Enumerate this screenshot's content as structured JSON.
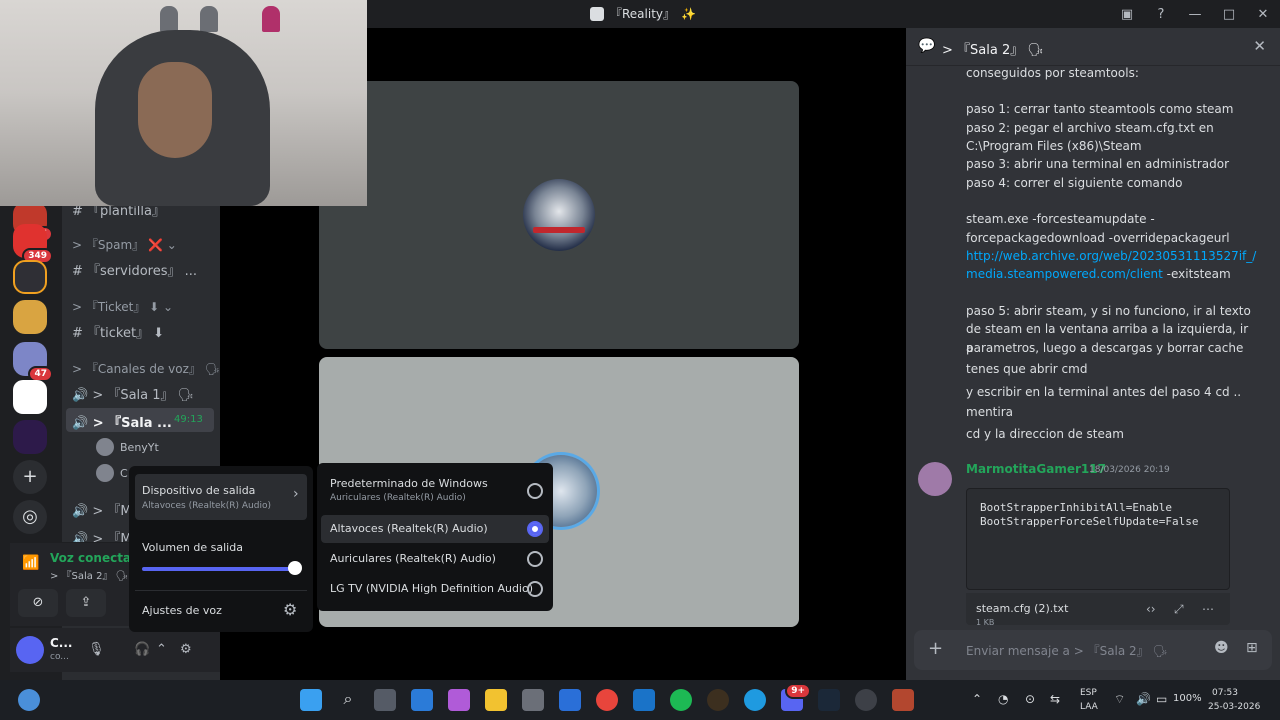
{
  "window": {
    "title": "『Reality』",
    "title_suffix": "✨",
    "controls": [
      "▣",
      "?",
      "—",
      "□",
      "✕"
    ]
  },
  "rail": {
    "badges": [
      "26",
      "349",
      "47"
    ]
  },
  "channels": {
    "items": [
      {
        "label": "#  『plantilla』"
      },
      {
        "label": "> 『Spam』 ❌ ⌄"
      },
      {
        "label": "#  『servidores』 ..."
      },
      {
        "label": "> 『Ticket』 ⬇ ⌄"
      },
      {
        "label": "#  『ticket』 ⬇"
      },
      {
        "label": "> 『Canales de voz』 🗣 ⌄"
      },
      {
        "label": "🔊 > 『Sala 1』 🗣"
      },
      {
        "label": "🔊 > 『Sala ..."
      }
    ],
    "active_timer": "49:13",
    "voice_users": [
      "BenyYt",
      "C"
    ],
    "more": [
      "🔊 > 『M",
      "🔊 > 『M"
    ]
  },
  "voice_panel": {
    "status": "Voz conectad",
    "location": "> 『Sala 2』 🗣 /"
  },
  "user_panel": {
    "name": "C...",
    "status": "co..."
  },
  "audio_menu": {
    "device_title": "Dispositivo de salida",
    "device_value": "Altavoces (Realtek(R) Audio)",
    "volume_label": "Volumen de salida",
    "volume_level": 1.0,
    "settings_label": "Ajustes de voz"
  },
  "device_options": [
    {
      "label": "Predeterminado de Windows",
      "sub": "Auriculares (Realtek(R) Audio)",
      "selected": false
    },
    {
      "label": "Altavoces (Realtek(R) Audio)",
      "selected": true
    },
    {
      "label": "Auriculares (Realtek(R) Audio)",
      "selected": false
    },
    {
      "label": "LG TV (NVIDIA High Definition Audio)",
      "selected": false
    }
  ],
  "chat": {
    "title": "> 『Sala 2』 🗣",
    "lines": [
      "conseguidos por steamtools:",
      "paso 1: cerrar tanto steamtools como steam",
      "paso 2: pegar el archivo steam.cfg.txt en",
      "C:\\Program Files (x86)\\Steam",
      "paso 3: abrir una terminal en administrador",
      "paso 4: correr el siguiente comando",
      "steam.exe -forcesteamupdate -",
      "forcepackagedownload -overridepackageurl",
      "http://web.archive.org/web/20230531113527if_/",
      "media.steampowered.com/client",
      " -exitsteam",
      "paso 5: abrir steam, y si no funciono, ir al texto",
      "de steam en la ventana arriba a la izquierda, ir a",
      "parametros, luego a descargas y borrar cache",
      "tenes que abrir cmd",
      "y escribir en la terminal antes del paso 4 cd ..",
      "mentira",
      "cd y la direccion de steam"
    ],
    "author": "MarmotitaGamer117",
    "author_time": "18/03/2026 20:19",
    "code": [
      "BootStrapperInhibitAll=Enable",
      "BootStrapperForceSelfUpdate=False"
    ],
    "file_name": "steam.cfg (2).txt",
    "file_size": "1 KB",
    "input_placeholder": "Enviar mensaje a > 『Sala 2』 🗣"
  },
  "taskbar": {
    "lang1": "ESP",
    "lang2": "LAA",
    "battery": "100%",
    "time": "07:53",
    "date": "25-03-2026",
    "discord_badge": "9+"
  },
  "colors": {
    "accent": "#5865f2",
    "online": "#23a55a",
    "link": "#00a8fc",
    "danger": "#da373c"
  }
}
